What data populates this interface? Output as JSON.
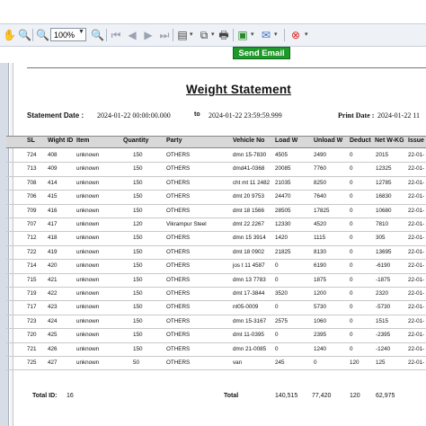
{
  "toolbar": {
    "zoom": "100%",
    "send_email": "Send Email"
  },
  "report": {
    "title": "Weight Statement",
    "statement_date_label": "Statement Date :",
    "date_from": "2024-01-22 00:00:00.000",
    "to_label": "to",
    "date_to": "2024-01-22 23:59:59.999",
    "print_date_label": "Print Date :",
    "print_date": "2024-01-22 11"
  },
  "columns": [
    "SL",
    "Wight ID",
    "Item",
    "Quantity",
    "Party",
    "Vehicle No",
    "Load W",
    "Unload W",
    "Deduct",
    "Net W-KG",
    "Issue"
  ],
  "rows": [
    [
      "724",
      "408",
      "unknown",
      "150",
      "OTHERS",
      "dmn 15-7830",
      "4505",
      "2490",
      "0",
      "2015",
      "22-01-"
    ],
    [
      "713",
      "409",
      "unknown",
      "150",
      "OTHERS",
      "dmd41-0368",
      "20085",
      "7760",
      "0",
      "12325",
      "22-01-"
    ],
    [
      "708",
      "414",
      "unknown",
      "150",
      "OTHERS",
      "cht mt 11 2482",
      "21035",
      "8250",
      "0",
      "12785",
      "22-01-"
    ],
    [
      "706",
      "415",
      "unknown",
      "150",
      "OTHERS",
      "dmt 20 9753",
      "24470",
      "7640",
      "0",
      "16830",
      "22-01-"
    ],
    [
      "709",
      "416",
      "unknown",
      "150",
      "OTHERS",
      "dmt 18 1566",
      "28505",
      "17825",
      "0",
      "10680",
      "22-01-"
    ],
    [
      "707",
      "417",
      "unknown",
      "120",
      "Vikrampur Steel",
      "dmt 22 2267",
      "12330",
      "4520",
      "0",
      "7810",
      "22-01-"
    ],
    [
      "712",
      "418",
      "unknown",
      "150",
      "OTHERS",
      "dmn 15 3914",
      "1420",
      "1115",
      "0",
      "305",
      "22-01-"
    ],
    [
      "722",
      "419",
      "unknown",
      "150",
      "OTHERS",
      "dmt 18 0902",
      "21825",
      "8130",
      "0",
      "13695",
      "22-01-"
    ],
    [
      "714",
      "420",
      "unknown",
      "150",
      "OTHERS",
      "jos t 11 4587",
      "0",
      "6190",
      "0",
      "-6190",
      "22-01-"
    ],
    [
      "715",
      "421",
      "unknown",
      "150",
      "OTHERS",
      "dmn 13 7783",
      "0",
      "1875",
      "0",
      "-1875",
      "22-01-"
    ],
    [
      "719",
      "422",
      "unknown",
      "150",
      "OTHERS",
      "dmt 17-3844",
      "3520",
      "1200",
      "0",
      "2320",
      "22-01-"
    ],
    [
      "717",
      "423",
      "unknown",
      "150",
      "OTHERS",
      "nt05-0009",
      "0",
      "5730",
      "0",
      "-5730",
      "22-01-"
    ],
    [
      "723",
      "424",
      "unknown",
      "150",
      "OTHERS",
      "dmn 15-3167",
      "2575",
      "1060",
      "0",
      "1515",
      "22-01-"
    ],
    [
      "720",
      "425",
      "unknown",
      "150",
      "OTHERS",
      "dmt 11-0395",
      "0",
      "2395",
      "0",
      "-2395",
      "22-01-"
    ],
    [
      "721",
      "426",
      "unknown",
      "150",
      "OTHERS",
      "dmn 21-0085",
      "0",
      "1240",
      "0",
      "-1240",
      "22-01-"
    ],
    [
      "725",
      "427",
      "unknown",
      "50",
      "OTHERS",
      "van",
      "245",
      "0",
      "120",
      "125",
      "22-01-"
    ]
  ],
  "footer": {
    "total_id_label": "Total ID:",
    "total_id": "16",
    "total_label": "Total",
    "load_total": "140,515",
    "unload_total": "77,420",
    "deduct_total": "120",
    "net_total": "62,975"
  }
}
